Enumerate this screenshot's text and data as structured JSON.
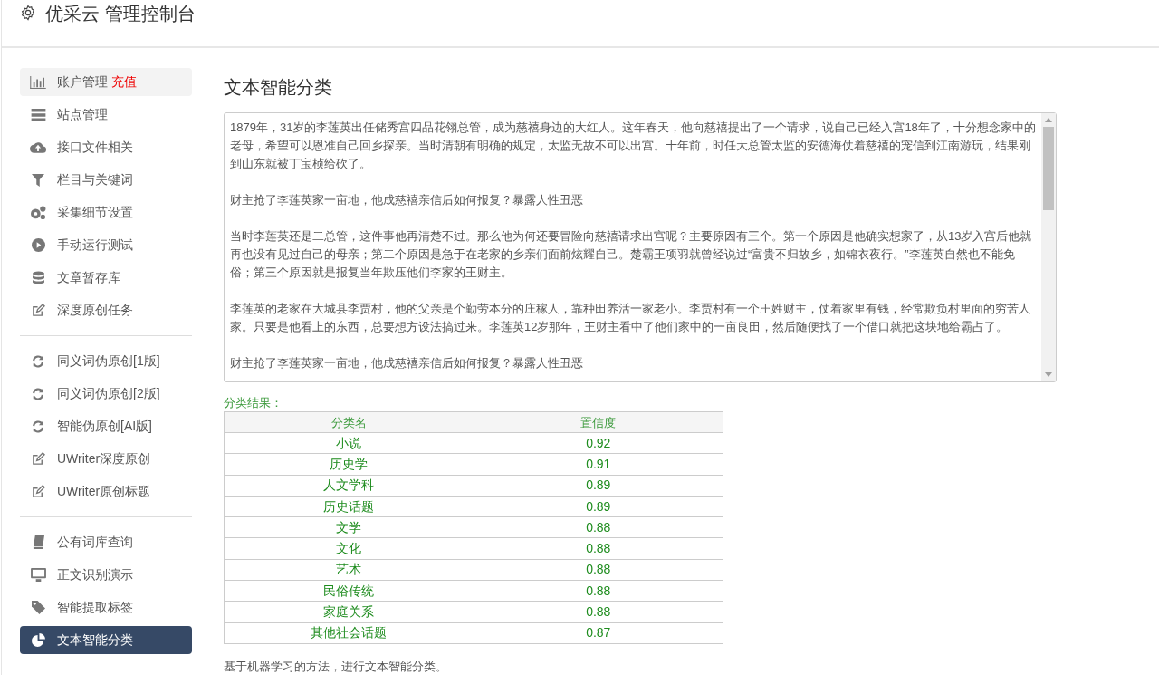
{
  "header": {
    "title": "优采云 管理控制台"
  },
  "sidebar": {
    "groups": [
      {
        "items": [
          {
            "label": "账户管理",
            "badge": "充值",
            "selected": false,
            "hovered": true
          },
          {
            "label": "站点管理",
            "selected": false
          },
          {
            "label": "接口文件相关",
            "selected": false
          },
          {
            "label": "栏目与关键词",
            "selected": false
          },
          {
            "label": "采集细节设置",
            "selected": false
          },
          {
            "label": "手动运行测试",
            "selected": false
          },
          {
            "label": "文章暂存库",
            "selected": false
          },
          {
            "label": "深度原创任务",
            "selected": false
          }
        ]
      },
      {
        "items": [
          {
            "label": "同义词伪原创[1版]",
            "selected": false
          },
          {
            "label": "同义词伪原创[2版]",
            "selected": false
          },
          {
            "label": "智能伪原创[AI版]",
            "selected": false
          },
          {
            "label": "UWriter深度原创",
            "selected": false
          },
          {
            "label": "UWriter原创标题",
            "selected": false
          }
        ]
      },
      {
        "items": [
          {
            "label": "公有词库查询",
            "selected": false
          },
          {
            "label": "正文识别演示",
            "selected": false
          },
          {
            "label": "智能提取标签",
            "selected": false
          },
          {
            "label": "文本智能分类",
            "selected": true
          }
        ]
      }
    ]
  },
  "main": {
    "title": "文本智能分类",
    "text_input": {
      "paragraphs": [
        "1879年，31岁的李莲英出任储秀宫四品花翎总管，成为慈禧身边的大红人。这年春天，他向慈禧提出了一个请求，说自己已经入宫18年了，十分想念家中的老母，希望可以恩准自己回乡探亲。当时清朝有明确的规定，太监无故不可以出宫。十年前，时任大总管太监的安德海仗着慈禧的宠信到江南游玩，结果刚到山东就被丁宝桢给砍了。",
        "财主抢了李莲英家一亩地，他成慈禧亲信后如何报复？暴露人性丑恶",
        "当时李莲英还是二总管，这件事他再清楚不过。那么他为何还要冒险向慈禧请求出宫呢？主要原因有三个。第一个原因是他确实想家了，从13岁入宫后他就再也没有见过自己的母亲；第二个原因是急于在老家的乡亲们面前炫耀自己。楚霸王项羽就曾经说过“富贵不归故乡，如锦衣夜行。”李莲英自然也不能免俗；第三个原因就是报复当年欺压他们李家的王财主。",
        "李莲英的老家在大城县李贾村，他的父亲是个勤劳本分的庄稼人，靠种田养活一家老小。李贾村有一个王姓财主，仗着家里有钱，经常欺负村里面的穷苦人家。只要是他看上的东西，总要想方设法搞过来。李莲英12岁那年，王财主看中了他们家中的一亩良田，然后随便找了一个借口就把这块地给霸占了。",
        "财主抢了李莲英家一亩地，他成慈禧亲信后如何报复？暴露人性丑恶"
      ]
    },
    "result_label": "分类结果：",
    "table": {
      "columns": [
        "分类名",
        "置信度"
      ],
      "rows": [
        [
          "小说",
          "0.92"
        ],
        [
          "历史学",
          "0.91"
        ],
        [
          "人文学科",
          "0.89"
        ],
        [
          "历史话题",
          "0.89"
        ],
        [
          "文学",
          "0.88"
        ],
        [
          "文化",
          "0.88"
        ],
        [
          "艺术",
          "0.88"
        ],
        [
          "民俗传统",
          "0.88"
        ],
        [
          "家庭关系",
          "0.88"
        ],
        [
          "其他社会话题",
          "0.87"
        ]
      ]
    },
    "footnote": "基于机器学习的方法，进行文本智能分类。"
  }
}
